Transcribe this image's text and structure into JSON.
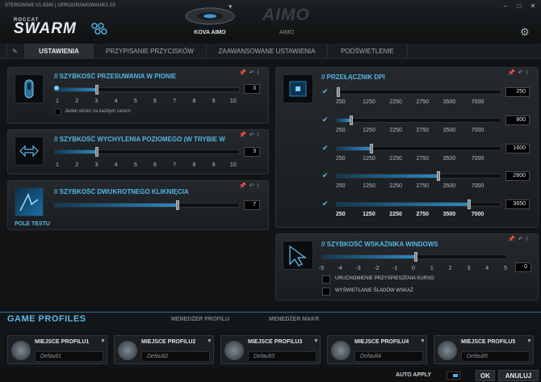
{
  "window": {
    "version": "STEROWNIK V1.9345 | OPROGRAMOWANIE1.03",
    "minimize": "–",
    "maximize": "□",
    "close": "✕"
  },
  "brand": {
    "roccat": "ROCCAT",
    "swarm": "SWARM"
  },
  "devices": {
    "active": "KOVA AIMO",
    "other": "AIMO",
    "watermark": "AIMO"
  },
  "tabs": [
    "USTAWIENIA",
    "PRZYPISANIE PRZYCISKÓW",
    "ZAAWANSOWANE USTAWIENIA",
    "PODŚWIETLENIE"
  ],
  "vertical": {
    "title": "// SZYBKOŚĆ PRZESUWANIA W PIONIE",
    "value": "3",
    "level": 3,
    "ticks": [
      "1",
      "2",
      "3",
      "4",
      "5",
      "6",
      "7",
      "8",
      "9",
      "10"
    ],
    "option": "Jeden ekran za każdym razem"
  },
  "tilt": {
    "title": "// SZYBKOŚĆ WYCHYLENIA POZIOMEGO (W TRYBIE W",
    "value": "3",
    "level": 3,
    "ticks": [
      "1",
      "2",
      "3",
      "4",
      "5",
      "6",
      "7",
      "8",
      "9",
      "10"
    ]
  },
  "dblclick": {
    "title": "// SZYBKOŚĆ DWUKROTNEGO KLIKNIĘCIA",
    "value": "7",
    "level": 0.69,
    "test_label": "POLE TESTU"
  },
  "dpi": {
    "title": "// PRZEŁĄCZNIK DPI",
    "scale": [
      "250",
      "1250",
      "2250",
      "2750",
      "3500",
      "7000"
    ],
    "rows": [
      {
        "value": "250",
        "level": 0.0
      },
      {
        "value": "800",
        "level": 0.08
      },
      {
        "value": "1600",
        "level": 0.2
      },
      {
        "value": "2800",
        "level": 0.61
      },
      {
        "value": "3650",
        "level": 0.8
      }
    ]
  },
  "windows": {
    "title": "// SZYBKOŚĆ WSKAŹNIKA WINDOWS",
    "value": "0",
    "level": 0.5,
    "ticks": [
      "-5",
      "-4",
      "-3",
      "-2",
      "-1",
      "0",
      "1",
      "2",
      "3",
      "4",
      "5"
    ],
    "opt1": "URUCHOMIENIE PRZYSPIESZENIA KURSO",
    "opt2": "WYŚWIETLANIE ŚLADÓW WSKAŹ"
  },
  "profiles": {
    "title": "GAME PROFILES",
    "tab1": "MENEDŻER PROFILU",
    "tab2": "MENEDŻER MAKR",
    "items": [
      {
        "name": "MIEJSCE PROFILU1",
        "default": "Default1"
      },
      {
        "name": "MIEJSCE PROFILU2",
        "default": "Default2"
      },
      {
        "name": "MIEJSCE PROFILU3",
        "default": "Default3"
      },
      {
        "name": "MIEJSCE PROFILU4",
        "default": "Default4"
      },
      {
        "name": "MIEJSCE PROFILU5",
        "default": "Default5"
      }
    ]
  },
  "footer": {
    "auto_apply": "AUTO APPLY",
    "ok": "OK",
    "cancel": "ANULUJ"
  },
  "icons": {
    "pin": "pin-icon",
    "undo": "undo-icon",
    "info": "info-icon",
    "gear": "gear-icon"
  },
  "colors": {
    "accent": "#54b6e8",
    "fill": "#2f88c0"
  }
}
